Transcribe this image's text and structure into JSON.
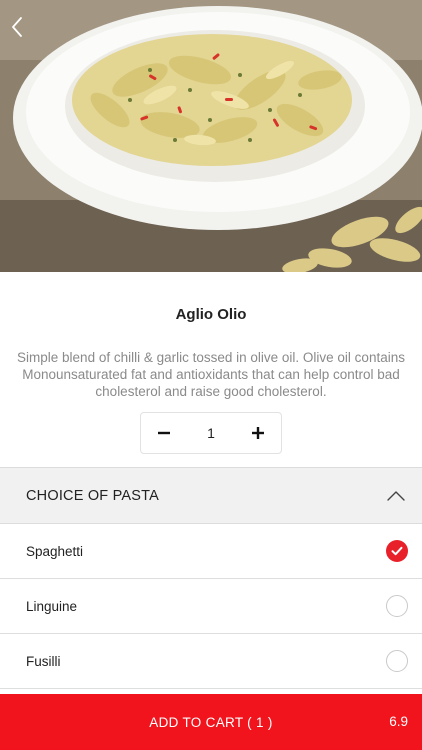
{
  "product": {
    "title": "Aglio Olio",
    "description": "Simple blend of chilli & garlic tossed in olive oil. Olive oil contains Monounsaturated fat and antioxidants that can help control bad cholesterol and raise good cholesterol.",
    "quantity": "1"
  },
  "section": {
    "title": "CHOICE OF PASTA",
    "options": [
      {
        "label": "Spaghetti",
        "selected": true
      },
      {
        "label": "Linguine",
        "selected": false
      },
      {
        "label": "Fusilli",
        "selected": false
      }
    ]
  },
  "cart": {
    "label": "ADD TO CART  ( 1 )",
    "price": "6.9"
  },
  "colors": {
    "accent": "#f2141d",
    "checked": "#e8202a"
  },
  "icons": [
    "chevron-left-icon",
    "minus-icon",
    "plus-icon",
    "chevron-up-icon",
    "checkmark-icon"
  ]
}
